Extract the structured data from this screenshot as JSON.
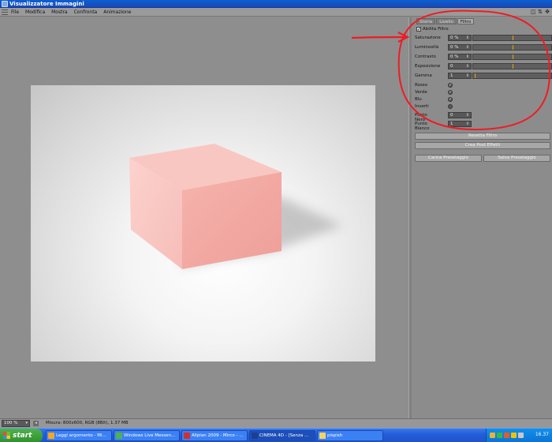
{
  "window": {
    "title": "Visualizzatore Immagini",
    "window_controls": [
      "◫",
      "⇅",
      "✥"
    ]
  },
  "menubar": {
    "items": [
      "File",
      "Modifica",
      "Mostra",
      "Confronta",
      "Animazione"
    ]
  },
  "panel": {
    "tabs": [
      {
        "label": "Storia",
        "active": false
      },
      {
        "label": "Livello",
        "active": false
      },
      {
        "label": "Filtro",
        "active": true
      }
    ],
    "enable_filter": {
      "label": "Abilita Filtro",
      "checked": true
    },
    "sliders": [
      {
        "label": "Saturazione",
        "value": "0 %",
        "marker_fraction": 0.5
      },
      {
        "label": "Luminosità",
        "value": "0 %",
        "marker_fraction": 0.5
      },
      {
        "label": "Contrasto",
        "value": "0 %",
        "marker_fraction": 0.5
      },
      {
        "label": "Esposizione",
        "value": "0",
        "marker_fraction": 0.5
      },
      {
        "label": "Gamma",
        "value": "1",
        "marker_fraction": 0.02
      }
    ],
    "channels": [
      {
        "label": "Rosso",
        "checked": true
      },
      {
        "label": "Verde",
        "checked": true
      },
      {
        "label": "Blu",
        "checked": true
      },
      {
        "label": "Inverti",
        "checked": false
      }
    ],
    "points": [
      {
        "label": "Punto Nero",
        "value": "0"
      },
      {
        "label": "Punto Bianco",
        "value": "1"
      }
    ],
    "buttons": {
      "reset": "Resetta Filtro",
      "create_post": "Crea Post Effetti",
      "load_preset": "Carica Preselaggio",
      "save_preset": "Salva Preselaggio"
    }
  },
  "statusbar": {
    "zoom": "100 %",
    "info": "Misura: 800x600, RGB (8Bit), 1.37 MB"
  },
  "taskbar": {
    "start_label": "start",
    "tasks": [
      {
        "label": "Leggi argomento - Mi...",
        "icon_color": "#f5a623",
        "active": false
      },
      {
        "label": "Windows Live Messen...",
        "icon_color": "#4fb24b",
        "active": false
      },
      {
        "label": "Allplan 2009 - Mirco - ...",
        "icon_color": "#d0312d",
        "active": false
      },
      {
        "label": "CINEMA 4D - [Senza ...",
        "icon_color": "#1c3f8f",
        "active": true
      },
      {
        "label": "pispish",
        "icon_color": "#f4d35e",
        "active": false
      }
    ],
    "tray_icons": [
      "#e9b23a",
      "#3ab54a",
      "#e25b2b",
      "#f2c200",
      "#c8c8c8"
    ],
    "clock": "16.37"
  },
  "colors": {
    "cube": "#f7b7b2",
    "slider_marker": "#e0a318",
    "annotation": "#ee1c24"
  }
}
